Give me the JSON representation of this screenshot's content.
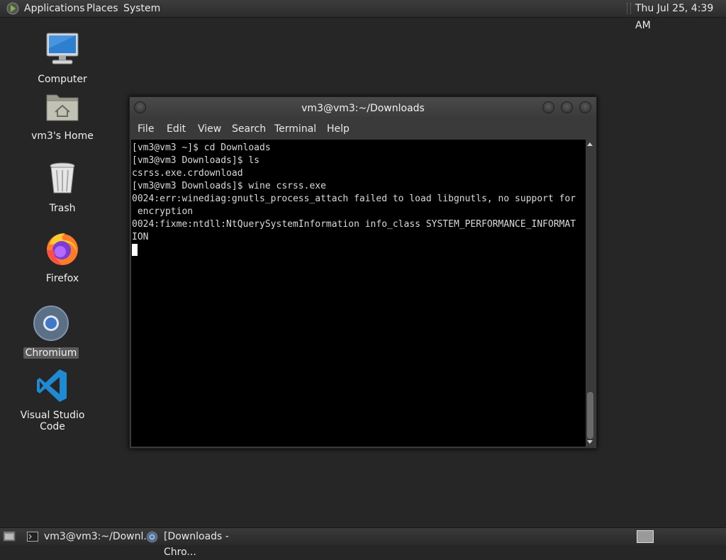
{
  "top_panel": {
    "menus": [
      "Applications",
      "Places",
      "System"
    ],
    "clock": "Thu Jul 25,  4:39 AM"
  },
  "desktop": {
    "icons": [
      {
        "label": "Computer",
        "icon": "computer-icon"
      },
      {
        "label": "vm3's Home",
        "icon": "home-folder-icon"
      },
      {
        "label": "Trash",
        "icon": "trash-icon"
      },
      {
        "label": "Firefox",
        "icon": "firefox-icon"
      },
      {
        "label": "Chromium",
        "icon": "chromium-icon",
        "selected": true
      },
      {
        "label": "Visual Studio Code",
        "icon": "vscode-icon"
      }
    ]
  },
  "terminal": {
    "title": "vm3@vm3:~/Downloads",
    "menu": [
      "File",
      "Edit",
      "View",
      "Search",
      "Terminal",
      "Help"
    ],
    "lines": [
      "[vm3@vm3 ~]$ cd Downloads",
      "[vm3@vm3 Downloads]$ ls",
      "csrss.exe.crdownload",
      "[vm3@vm3 Downloads]$ wine csrss.exe",
      "0024:err:winediag:gnutls_process_attach failed to load libgnutls, no support for",
      " encryption",
      "0024:fixme:ntdll:NtQuerySystemInformation info_class SYSTEM_PERFORMANCE_INFORMAT",
      "ION"
    ]
  },
  "taskbar": {
    "items": [
      {
        "label": "vm3@vm3:~/Downl...",
        "icon": "terminal-icon"
      },
      {
        "label": "[Downloads - Chro...",
        "icon": "chromium-icon"
      }
    ]
  }
}
